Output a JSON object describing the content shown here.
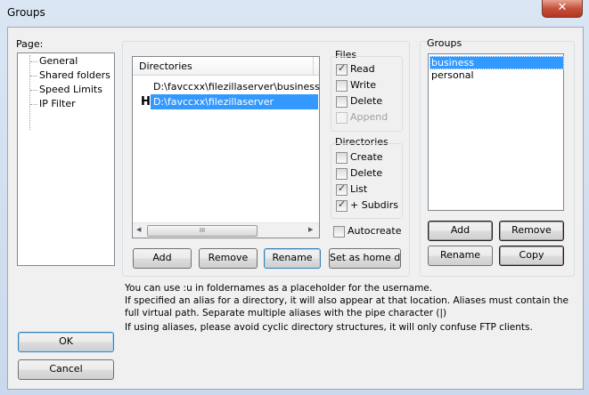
{
  "window": {
    "title": "Groups",
    "close_glyph": "✕"
  },
  "page_panel": {
    "label": "Page:",
    "items": [
      "General",
      "Shared folders",
      "Speed Limits",
      "IP Filter"
    ]
  },
  "directories": {
    "header": "Directories",
    "rows": [
      {
        "marker": "",
        "path": "D:\\favccxx\\filezillaserver\\business",
        "selected": false
      },
      {
        "marker": "H",
        "path": "D:\\favccxx\\filezillaserver",
        "selected": true
      }
    ],
    "scroll_thumb_glyph": "III",
    "buttons": {
      "add": "Add",
      "remove": "Remove",
      "rename": "Rename",
      "set_home": "Set as home dir"
    }
  },
  "files": {
    "label": "Files",
    "options": [
      {
        "label": "Read",
        "checked": true,
        "enabled": true
      },
      {
        "label": "Write",
        "checked": false,
        "enabled": true
      },
      {
        "label": "Delete",
        "checked": false,
        "enabled": true
      },
      {
        "label": "Append",
        "checked": false,
        "enabled": false
      }
    ]
  },
  "dir_perms": {
    "label": "Directories",
    "options": [
      {
        "label": "Create",
        "checked": false
      },
      {
        "label": "Delete",
        "checked": false
      },
      {
        "label": "List",
        "checked": true
      },
      {
        "label": "+ Subdirs",
        "checked": true
      }
    ]
  },
  "autocreate": {
    "label": "Autocreate",
    "checked": false
  },
  "groups": {
    "label": "Groups",
    "items": [
      {
        "name": "business",
        "selected": true
      },
      {
        "name": "personal",
        "selected": false
      }
    ],
    "buttons": {
      "add": "Add",
      "remove": "Remove",
      "rename": "Rename",
      "copy": "Copy"
    }
  },
  "info": {
    "line1": "You can use :u in foldernames as a placeholder for the username.",
    "line2": "If specified an alias for a directory, it will also appear at that location. Aliases must contain the",
    "line3": "full virtual path. Separate multiple aliases with the pipe character (|)",
    "line4": "If using aliases, please avoid cyclic directory structures, it will only confuse FTP clients."
  },
  "footer": {
    "ok": "OK",
    "cancel": "Cancel"
  },
  "check_glyph": "✓"
}
